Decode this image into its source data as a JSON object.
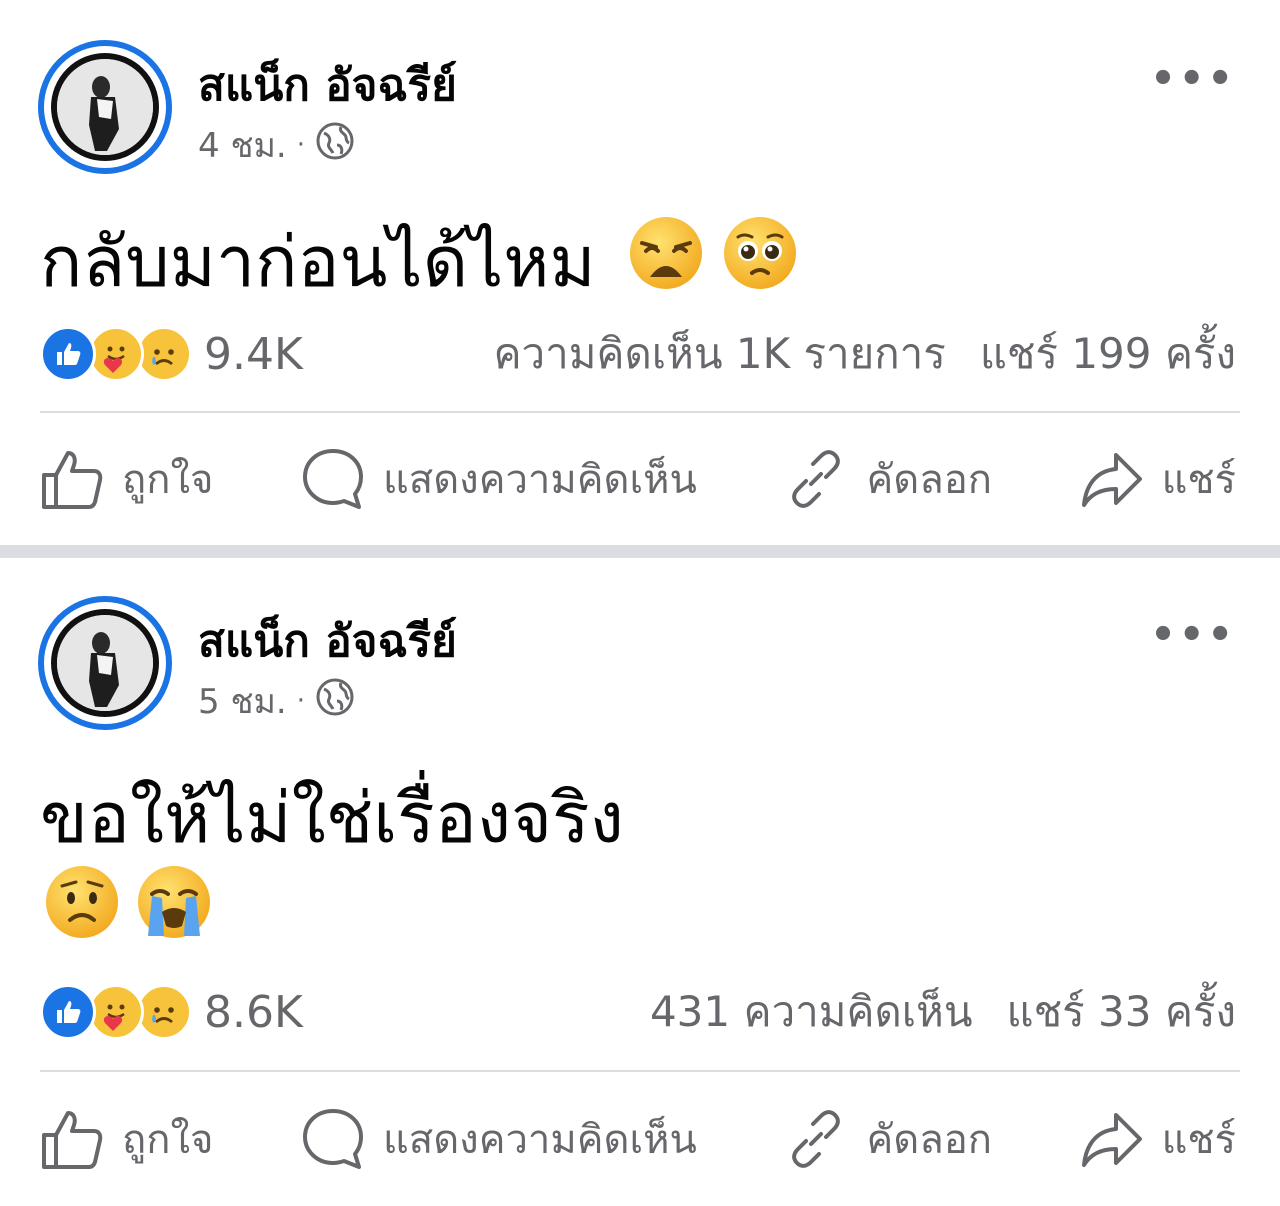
{
  "posts": [
    {
      "author": "สแน็ก อัจฉรีย์",
      "time": "4 ชม.",
      "text_lines": [
        "กลับมาก่อนได้ไหม"
      ],
      "inline_emojis": [
        "weary-face-emoji",
        "pleading-face-emoji"
      ],
      "reaction_count": "9.4K",
      "comments": "ความคิดเห็น 1K รายการ",
      "shares": "แชร์ 199 ครั้ง",
      "actions": {
        "like": "ถูกใจ",
        "comment": "แสดงความคิดเห็น",
        "copy": "คัดลอก",
        "share": "แชร์"
      }
    },
    {
      "author": "สแน็ก อัจฉรีย์",
      "time": "5 ชม.",
      "text_lines": [
        "ขอให้ไม่ใช่เรื่องจริง"
      ],
      "emoji_line": [
        "worried-face-emoji",
        "loudly-crying-face-emoji"
      ],
      "reaction_count": "8.6K",
      "comments": "431 ความคิดเห็น",
      "shares": "แชร์ 33 ครั้ง",
      "actions": {
        "like": "ถูกใจ",
        "comment": "แสดงความคิดเห็น",
        "copy": "คัดลอก",
        "share": "แชร์"
      }
    }
  ],
  "colors": {
    "accent_blue": "#1b74e4",
    "secondary_text": "#65676b",
    "separator": "#dcdde2"
  },
  "more_glyph": "•••",
  "meta_dot": "·"
}
